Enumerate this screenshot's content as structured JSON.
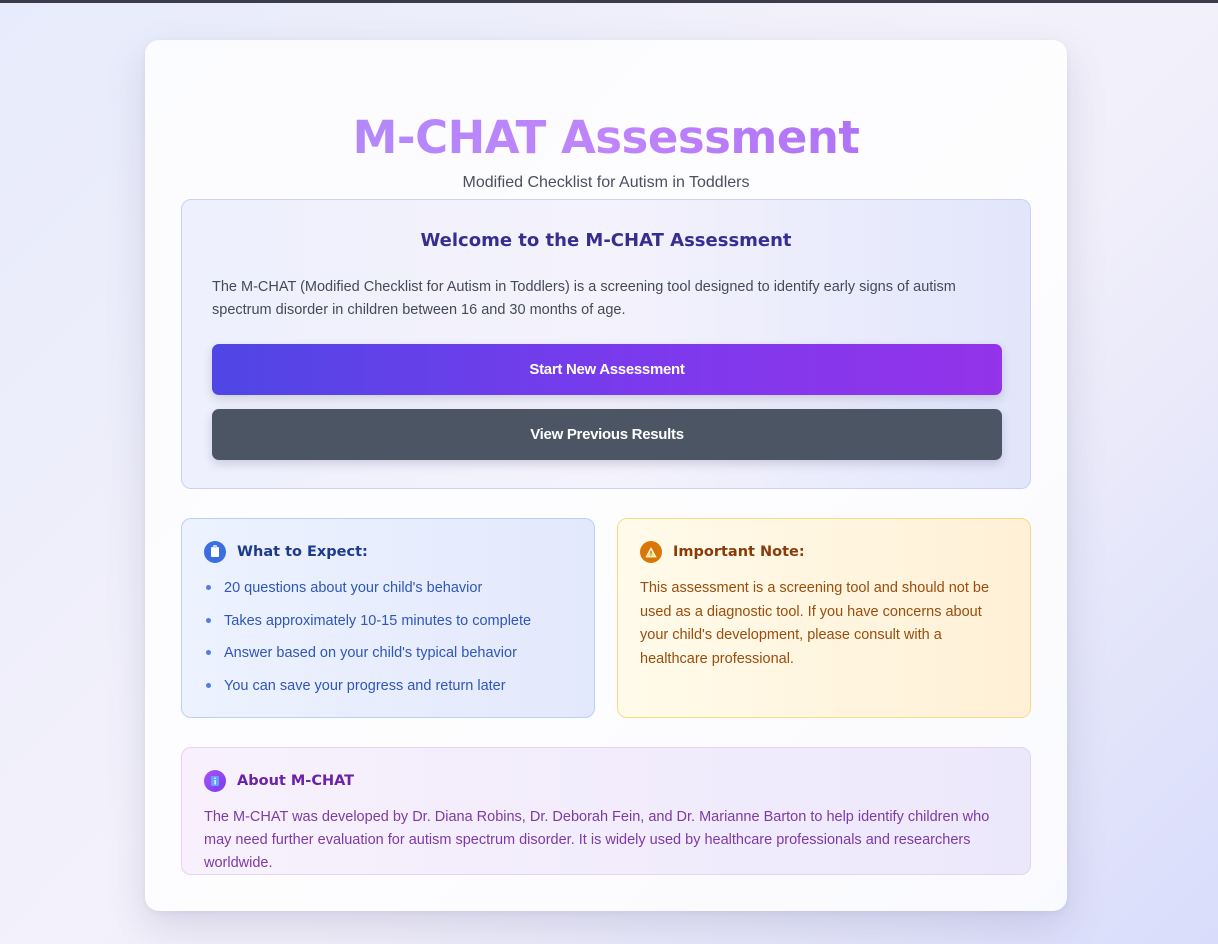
{
  "header": {
    "title": "M-CHAT Assessment",
    "subtitle": "Modified Checklist for Autism in Toddlers"
  },
  "welcome": {
    "heading": "Welcome to the M-CHAT Assessment",
    "description": "The M-CHAT (Modified Checklist for Autism in Toddlers) is a screening tool designed to identify early signs of autism spectrum disorder in children between 16 and 30 months of age.",
    "start_button": "Start New Assessment",
    "previous_button": "View Previous Results"
  },
  "expect": {
    "icon": "clipboard-icon",
    "title": "What to Expect:",
    "items": [
      "20 questions about your child's behavior",
      "Takes approximately 10-15 minutes to complete",
      "Answer based on your child's typical behavior",
      "You can save your progress and return later"
    ]
  },
  "note": {
    "icon": "warning-icon",
    "title": "Important Note:",
    "text": "This assessment is a screening tool and should not be used as a diagnostic tool. If you have concerns about your child's development, please consult with a healthcare professional."
  },
  "about": {
    "icon": "info-icon",
    "title": "About M-CHAT",
    "text": "The M-CHAT was developed by Dr. Diana Robins, Dr. Deborah Fein, and Dr. Marianne Barton to help identify children who may need further evaluation for autism spectrum disorder. It is widely used by healthcare professionals and researchers worldwide."
  },
  "colors": {
    "primary_gradient_start": "#4f46e5",
    "primary_gradient_end": "#9333ea",
    "secondary_button": "#4b5563",
    "title_gradient": "#a78bfa"
  }
}
